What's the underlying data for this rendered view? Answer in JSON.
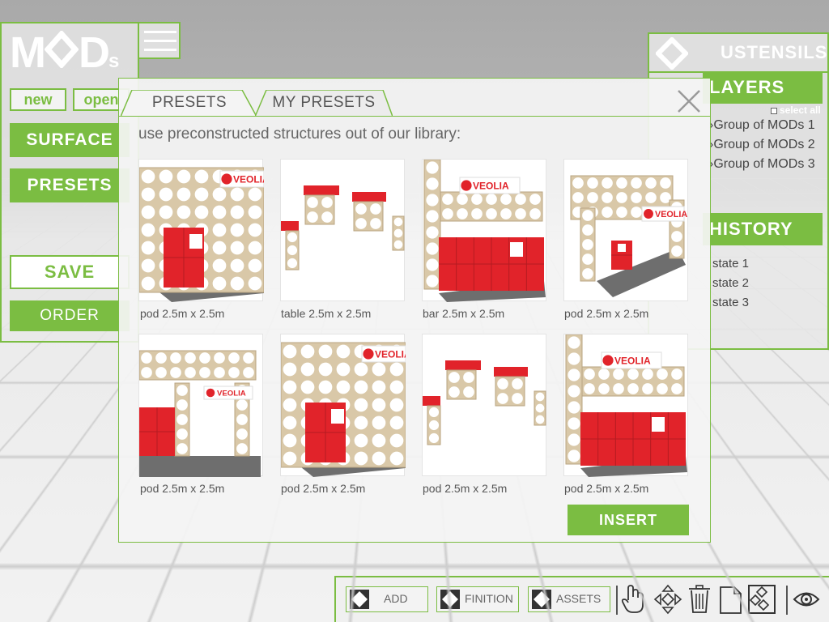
{
  "app": {
    "logo_text_left": "M",
    "logo_text_right": "D",
    "logo_suffix": "s"
  },
  "left_menu": {
    "new_label": "new",
    "open_label": "open",
    "surface_label": "SURFACE",
    "presets_label": "PRESETS",
    "save_label": "SAVE",
    "order_label": "ORDER"
  },
  "right_panel": {
    "title": "USTENSILS",
    "layers_title": "LAYERS",
    "select_all_label": "select all",
    "layers": [
      "Group of MODs 1",
      "Group of MODs 2",
      "Group of MODs 3"
    ],
    "history_title": "HISTORY",
    "history": [
      "state 1",
      "state 2",
      "state 3"
    ]
  },
  "dialog": {
    "tabs": [
      {
        "label": "PRESETS",
        "active": true
      },
      {
        "label": "MY PRESETS",
        "active": false
      }
    ],
    "instructions": "use preconstructed structures out of our library:",
    "presets": [
      {
        "label": "pod 2.5m x 2.5m",
        "thumb": "pod-corner-veolia"
      },
      {
        "label": "table 2.5m x 2.5m",
        "thumb": "tables"
      },
      {
        "label": "bar 2.5m x 2.5m",
        "thumb": "bar-veolia"
      },
      {
        "label": "pod 2.5m x 2.5m",
        "thumb": "pod-open-veolia"
      },
      {
        "label": "pod 2.5m x 2.5m",
        "thumb": "pod-gallery-veolia"
      },
      {
        "label": "pod 2.5m x 2.5m",
        "thumb": "pod-corner-veolia"
      },
      {
        "label": "pod 2.5m x 2.5m",
        "thumb": "tables"
      },
      {
        "label": "pod 2.5m x 2.5m",
        "thumb": "bar-veolia"
      }
    ],
    "brand_text": "VEOLIA",
    "insert_label": "INSERT"
  },
  "toolbar": {
    "add_label": "ADD",
    "finition_label": "FINITION",
    "assets_label": "ASSETS",
    "icons": [
      "hand-icon",
      "move-icon",
      "trash-icon",
      "copy-icon",
      "rotate-icon",
      "eye-icon"
    ]
  },
  "colors": {
    "accent_green": "#7bbd42",
    "brand_red": "#e1232a",
    "wood": "#d9c8a8"
  }
}
